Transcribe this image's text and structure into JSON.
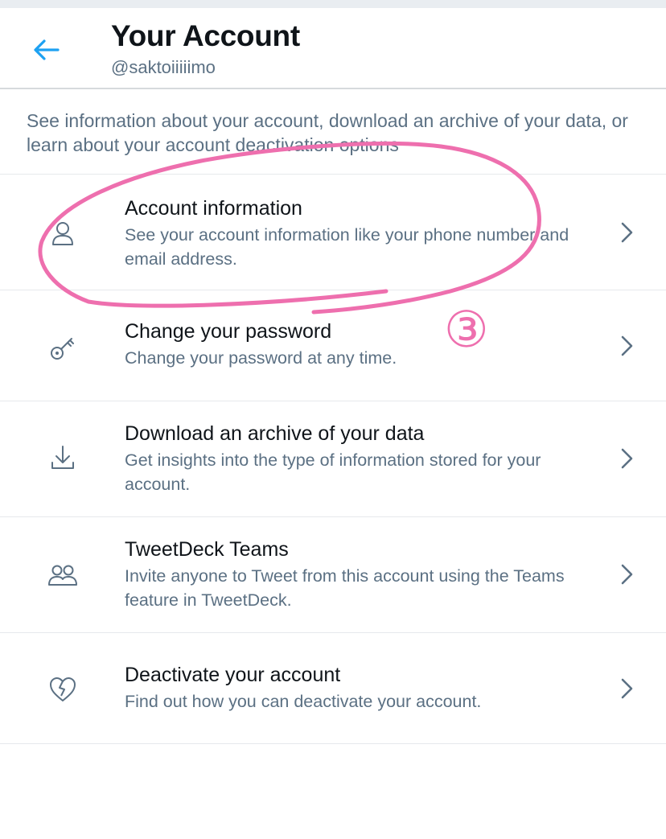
{
  "header": {
    "back_icon": "arrow-left-icon",
    "title": "Your Account",
    "handle": "@saktoiiiiimo",
    "accent_color": "#1da1f2"
  },
  "intro": "See information about your account, download an archive of your data, or learn about your account deactivation options",
  "rows": [
    {
      "icon": "person-icon",
      "label": "Account information",
      "desc": "See your account information like your phone number and email address."
    },
    {
      "icon": "key-icon",
      "label": "Change your password",
      "desc": "Change your password at any time."
    },
    {
      "icon": "download-icon",
      "label": "Download an archive of your data",
      "desc": "Get insights into the type of information stored for your account."
    },
    {
      "icon": "people-icon",
      "label": "TweetDeck Teams",
      "desc": "Invite anyone to Tweet from this account using the Teams feature in TweetDeck."
    },
    {
      "icon": "broken-heart-icon",
      "label": "Deactivate your account",
      "desc": "Find out how you can deactivate your account."
    }
  ],
  "annotation": {
    "marker": "③",
    "color": "#ee6fae"
  }
}
